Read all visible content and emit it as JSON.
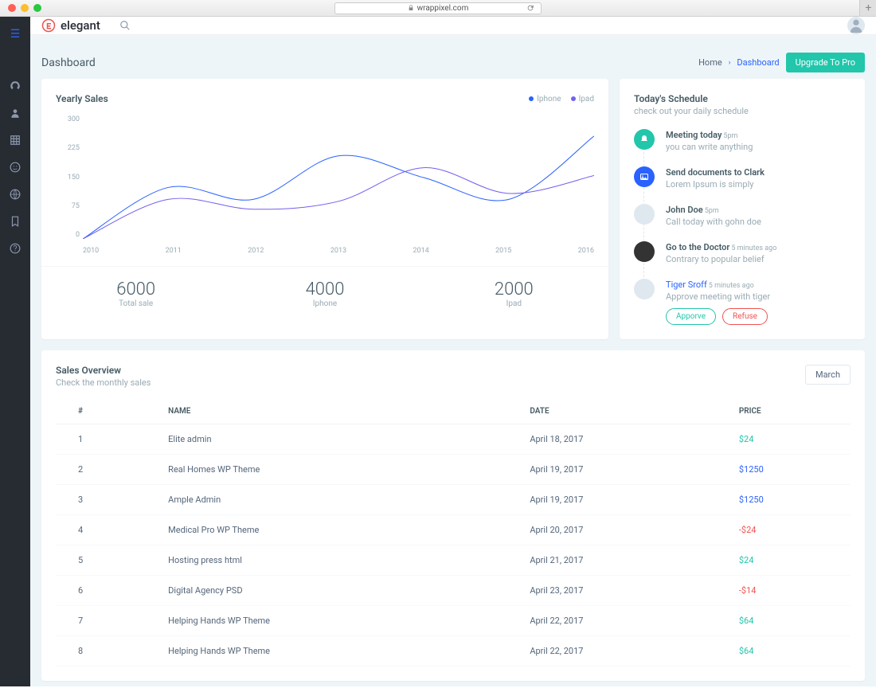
{
  "browser": {
    "url": "wrappixel.com"
  },
  "brand": {
    "name": "elegant"
  },
  "page": {
    "title": "Dashboard",
    "crumb_home": "Home",
    "crumb_active": "Dashboard",
    "upgrade": "Upgrade To Pro"
  },
  "sales": {
    "title": "Yearly Sales",
    "legend": {
      "a": "Iphone",
      "b": "Ipad"
    },
    "stats": [
      {
        "num": "6000",
        "lab": "Total sale"
      },
      {
        "num": "4000",
        "lab": "Iphone"
      },
      {
        "num": "2000",
        "lab": "Ipad"
      }
    ]
  },
  "schedule": {
    "title": "Today's Schedule",
    "subtitle": "check out your daily schedule",
    "items": [
      {
        "title": "Meeting today",
        "time": "5pm",
        "desc": "you can write anything"
      },
      {
        "title": "Send documents to Clark",
        "time": "",
        "desc": "Lorem Ipsum is simply"
      },
      {
        "title": "John Doe",
        "time": "5pm",
        "desc": "Call today with gohn doe"
      },
      {
        "title": "Go to the Doctor",
        "time": "5 minutes ago",
        "desc": "Contrary to popular belief"
      },
      {
        "title": "Tiger Sroff",
        "time": "5 minutes ago",
        "desc": "Approve meeting with tiger"
      }
    ],
    "approve": "Apporve",
    "refuse": "Refuse"
  },
  "overview": {
    "title": "Sales Overview",
    "subtitle": "Check the monthly sales",
    "month": "March",
    "cols": {
      "a": "#",
      "b": "NAME",
      "c": "DATE",
      "d": "PRICE"
    },
    "rows": [
      {
        "n": "1",
        "name": "Elite admin",
        "date": "April 18, 2017",
        "price": "$24",
        "cls": "pr-g"
      },
      {
        "n": "2",
        "name": "Real Homes WP Theme",
        "date": "April 19, 2017",
        "price": "$1250",
        "cls": "pr-b"
      },
      {
        "n": "3",
        "name": "Ample Admin",
        "date": "April 19, 2017",
        "price": "$1250",
        "cls": "pr-b"
      },
      {
        "n": "4",
        "name": "Medical Pro WP Theme",
        "date": "April 20, 2017",
        "price": "-$24",
        "cls": "pr-r"
      },
      {
        "n": "5",
        "name": "Hosting press html",
        "date": "April 21, 2017",
        "price": "$24",
        "cls": "pr-g"
      },
      {
        "n": "6",
        "name": "Digital Agency PSD",
        "date": "April 23, 2017",
        "price": "-$14",
        "cls": "pr-r"
      },
      {
        "n": "7",
        "name": "Helping Hands WP Theme",
        "date": "April 22, 2017",
        "price": "$64",
        "cls": "pr-g"
      },
      {
        "n": "8",
        "name": "Helping Hands WP Theme",
        "date": "April 22, 2017",
        "price": "$64",
        "cls": "pr-g"
      }
    ]
  },
  "chart_data": {
    "type": "line",
    "x": [
      "2010",
      "2011",
      "2012",
      "2013",
      "2014",
      "2015",
      "2016"
    ],
    "ylim": [
      0,
      300
    ],
    "yticks": [
      0,
      75,
      150,
      225,
      300
    ],
    "series": [
      {
        "name": "Iphone",
        "color": "#2962ff",
        "values": [
          0,
          130,
          100,
          210,
          155,
          100,
          260
        ]
      },
      {
        "name": "Ipad",
        "color": "#7460ee",
        "values": [
          0,
          100,
          75,
          95,
          180,
          115,
          160
        ]
      }
    ]
  }
}
